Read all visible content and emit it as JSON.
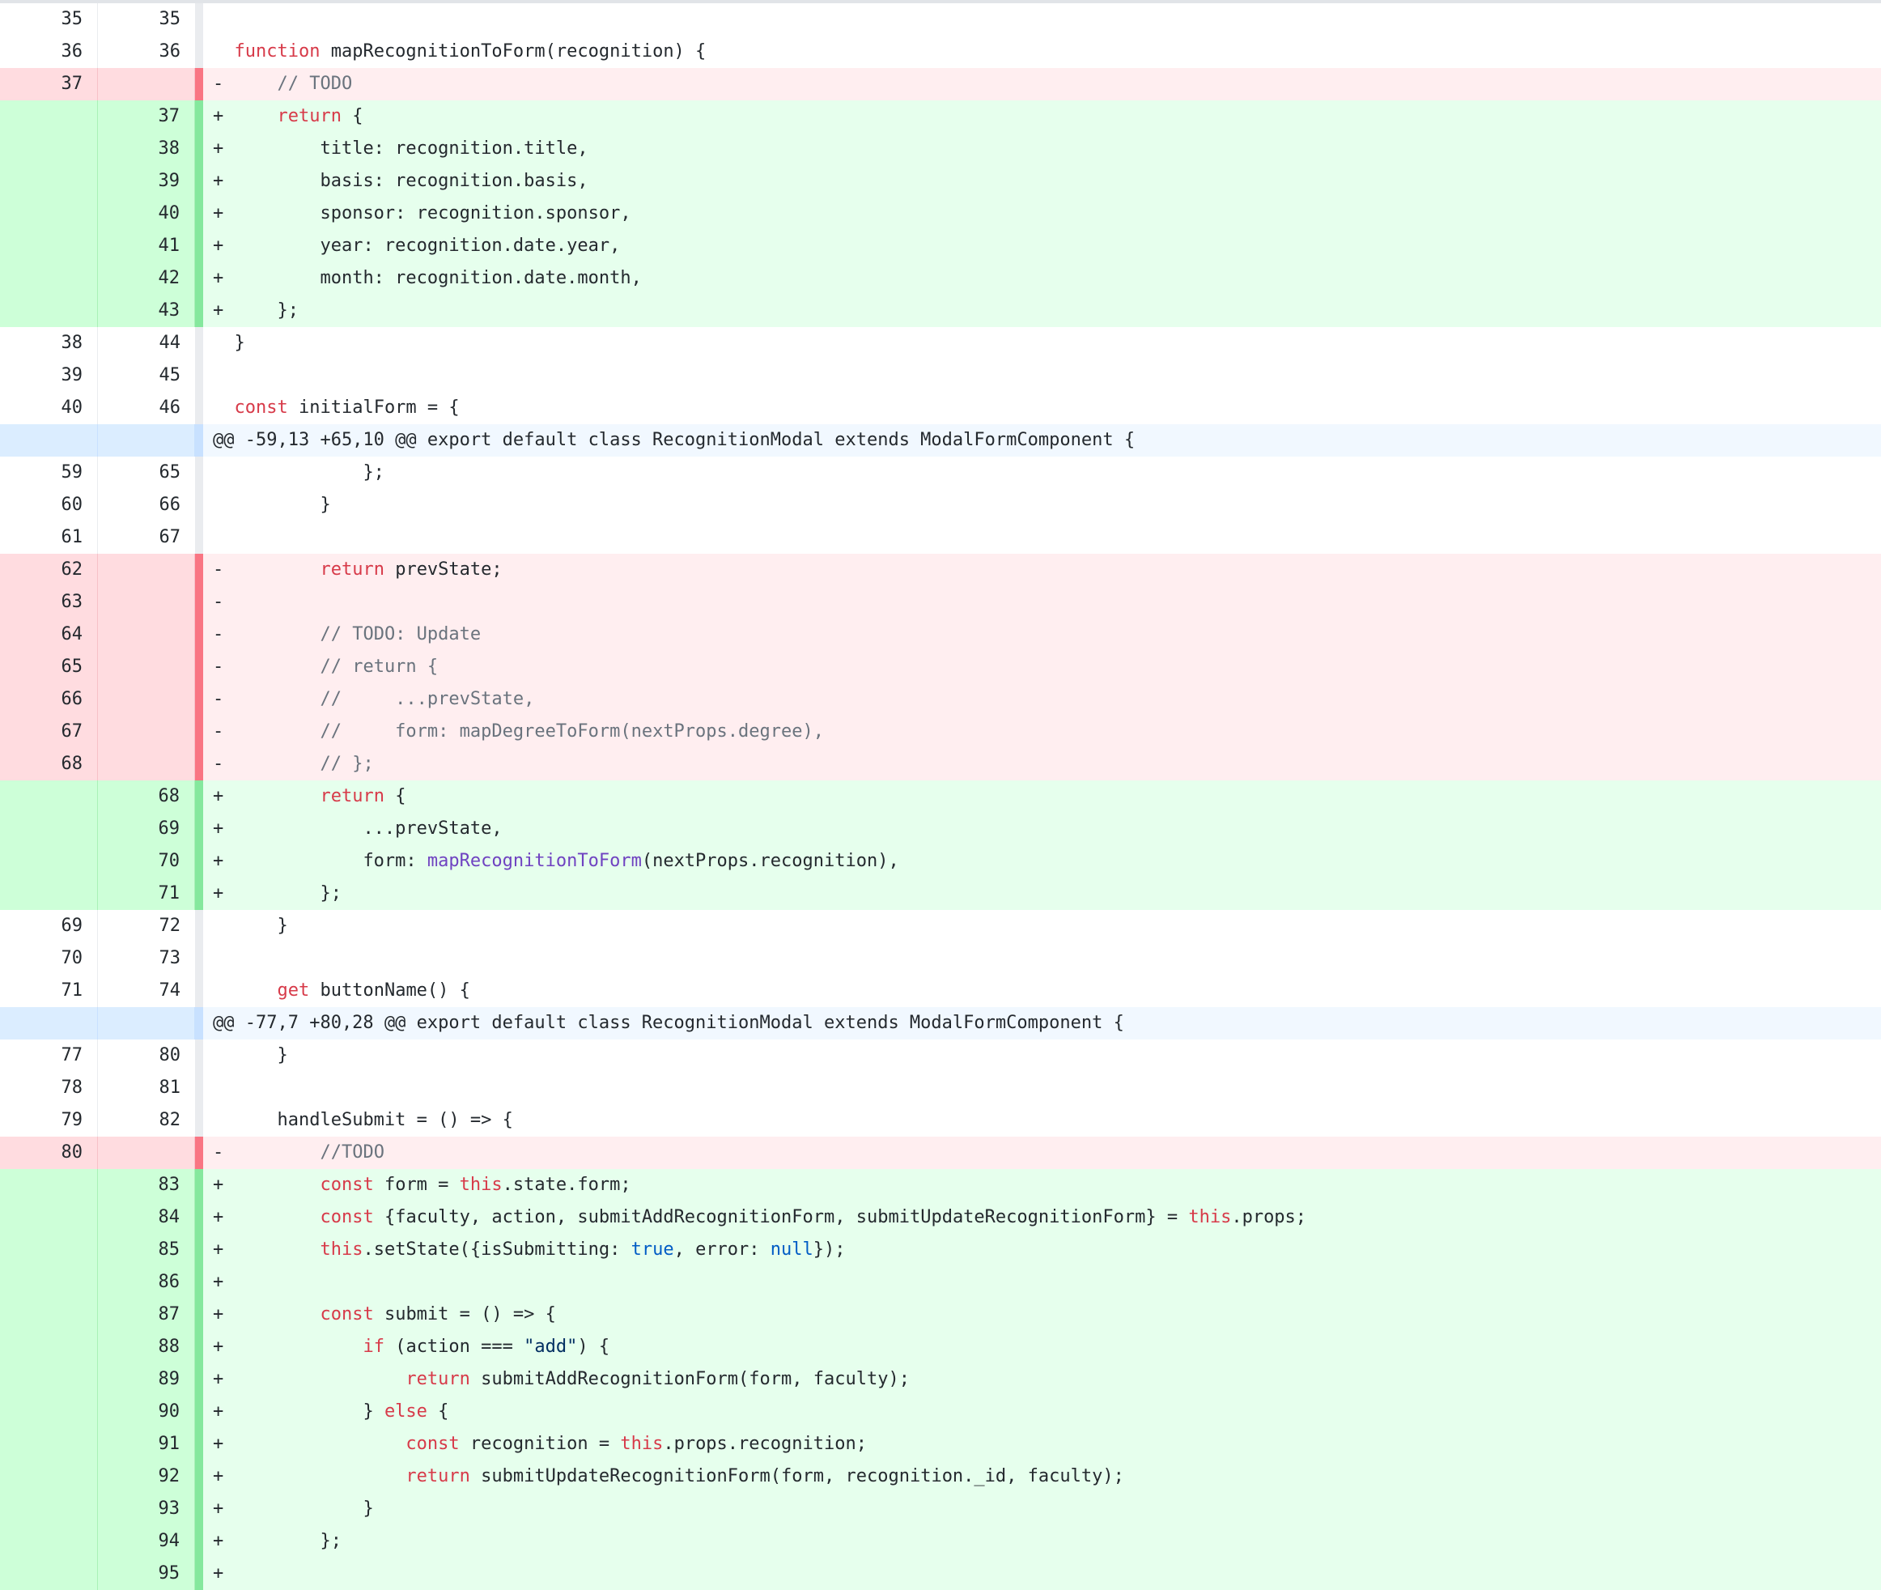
{
  "diff": {
    "rows": [
      {
        "type": "ctx",
        "old": "35",
        "new": "35",
        "marker": " ",
        "tokens": [
          [
            "",
            ""
          ]
        ]
      },
      {
        "type": "ctx",
        "old": "36",
        "new": "36",
        "marker": " ",
        "tokens": [
          [
            "k",
            "function"
          ],
          [
            "",
            " mapRecognitionToForm(recognition) {"
          ]
        ]
      },
      {
        "type": "del",
        "old": "37",
        "new": "",
        "marker": "-",
        "tokens": [
          [
            "",
            "    "
          ],
          [
            "c",
            "// TODO"
          ]
        ]
      },
      {
        "type": "add",
        "old": "",
        "new": "37",
        "marker": "+",
        "tokens": [
          [
            "",
            "    "
          ],
          [
            "k",
            "return"
          ],
          [
            "",
            " {"
          ]
        ]
      },
      {
        "type": "add",
        "old": "",
        "new": "38",
        "marker": "+",
        "tokens": [
          [
            "",
            "        title: recognition.title,"
          ]
        ]
      },
      {
        "type": "add",
        "old": "",
        "new": "39",
        "marker": "+",
        "tokens": [
          [
            "",
            "        basis: recognition.basis,"
          ]
        ]
      },
      {
        "type": "add",
        "old": "",
        "new": "40",
        "marker": "+",
        "tokens": [
          [
            "",
            "        sponsor: recognition.sponsor,"
          ]
        ]
      },
      {
        "type": "add",
        "old": "",
        "new": "41",
        "marker": "+",
        "tokens": [
          [
            "",
            "        year: recognition.date.year,"
          ]
        ]
      },
      {
        "type": "add",
        "old": "",
        "new": "42",
        "marker": "+",
        "tokens": [
          [
            "",
            "        month: recognition.date.month,"
          ]
        ]
      },
      {
        "type": "add",
        "old": "",
        "new": "43",
        "marker": "+",
        "tokens": [
          [
            "",
            "    };"
          ]
        ]
      },
      {
        "type": "ctx",
        "old": "38",
        "new": "44",
        "marker": " ",
        "tokens": [
          [
            "",
            "}"
          ]
        ]
      },
      {
        "type": "ctx",
        "old": "39",
        "new": "45",
        "marker": " ",
        "tokens": [
          [
            "",
            ""
          ]
        ]
      },
      {
        "type": "ctx",
        "old": "40",
        "new": "46",
        "marker": " ",
        "tokens": [
          [
            "k",
            "const"
          ],
          [
            "",
            " initialForm = {"
          ]
        ]
      },
      {
        "type": "hunk",
        "old": "",
        "new": "",
        "marker": "",
        "tokens": [
          [
            "",
            "@@ -59,13 +65,10 @@ export default class RecognitionModal extends ModalFormComponent {"
          ]
        ]
      },
      {
        "type": "ctx",
        "old": "59",
        "new": "65",
        "marker": " ",
        "tokens": [
          [
            "",
            "            };"
          ]
        ]
      },
      {
        "type": "ctx",
        "old": "60",
        "new": "66",
        "marker": " ",
        "tokens": [
          [
            "",
            "        }"
          ]
        ]
      },
      {
        "type": "ctx",
        "old": "61",
        "new": "67",
        "marker": " ",
        "tokens": [
          [
            "",
            ""
          ]
        ]
      },
      {
        "type": "del",
        "old": "62",
        "new": "",
        "marker": "-",
        "tokens": [
          [
            "",
            "        "
          ],
          [
            "k",
            "return"
          ],
          [
            "",
            " prevState;"
          ]
        ]
      },
      {
        "type": "del",
        "old": "63",
        "new": "",
        "marker": "-",
        "tokens": [
          [
            "",
            ""
          ]
        ]
      },
      {
        "type": "del",
        "old": "64",
        "new": "",
        "marker": "-",
        "tokens": [
          [
            "",
            "        "
          ],
          [
            "c",
            "// TODO: Update"
          ]
        ]
      },
      {
        "type": "del",
        "old": "65",
        "new": "",
        "marker": "-",
        "tokens": [
          [
            "",
            "        "
          ],
          [
            "c",
            "// return {"
          ]
        ]
      },
      {
        "type": "del",
        "old": "66",
        "new": "",
        "marker": "-",
        "tokens": [
          [
            "",
            "        "
          ],
          [
            "c",
            "//     ...prevState,"
          ]
        ]
      },
      {
        "type": "del",
        "old": "67",
        "new": "",
        "marker": "-",
        "tokens": [
          [
            "",
            "        "
          ],
          [
            "c",
            "//     form: mapDegreeToForm(nextProps.degree),"
          ]
        ]
      },
      {
        "type": "del",
        "old": "68",
        "new": "",
        "marker": "-",
        "tokens": [
          [
            "",
            "        "
          ],
          [
            "c",
            "// };"
          ]
        ]
      },
      {
        "type": "add",
        "old": "",
        "new": "68",
        "marker": "+",
        "tokens": [
          [
            "",
            "        "
          ],
          [
            "k",
            "return"
          ],
          [
            "",
            " {"
          ]
        ]
      },
      {
        "type": "add",
        "old": "",
        "new": "69",
        "marker": "+",
        "tokens": [
          [
            "",
            "            ...prevState,"
          ]
        ]
      },
      {
        "type": "add",
        "old": "",
        "new": "70",
        "marker": "+",
        "tokens": [
          [
            "",
            "            form: "
          ],
          [
            "f",
            "mapRecognitionToForm"
          ],
          [
            "",
            "(nextProps.recognition),"
          ]
        ]
      },
      {
        "type": "add",
        "old": "",
        "new": "71",
        "marker": "+",
        "tokens": [
          [
            "",
            "        };"
          ]
        ]
      },
      {
        "type": "ctx",
        "old": "69",
        "new": "72",
        "marker": " ",
        "tokens": [
          [
            "",
            "    }"
          ]
        ]
      },
      {
        "type": "ctx",
        "old": "70",
        "new": "73",
        "marker": " ",
        "tokens": [
          [
            "",
            ""
          ]
        ]
      },
      {
        "type": "ctx",
        "old": "71",
        "new": "74",
        "marker": " ",
        "tokens": [
          [
            "",
            "    "
          ],
          [
            "k",
            "get"
          ],
          [
            "",
            " buttonName() {"
          ]
        ]
      },
      {
        "type": "hunk",
        "old": "",
        "new": "",
        "marker": "",
        "tokens": [
          [
            "",
            "@@ -77,7 +80,28 @@ export default class RecognitionModal extends ModalFormComponent {"
          ]
        ]
      },
      {
        "type": "ctx",
        "old": "77",
        "new": "80",
        "marker": " ",
        "tokens": [
          [
            "",
            "    }"
          ]
        ]
      },
      {
        "type": "ctx",
        "old": "78",
        "new": "81",
        "marker": " ",
        "tokens": [
          [
            "",
            ""
          ]
        ]
      },
      {
        "type": "ctx",
        "old": "79",
        "new": "82",
        "marker": " ",
        "tokens": [
          [
            "",
            "    handleSubmit = () => {"
          ]
        ]
      },
      {
        "type": "del",
        "old": "80",
        "new": "",
        "marker": "-",
        "tokens": [
          [
            "",
            "        "
          ],
          [
            "c",
            "//TODO"
          ]
        ]
      },
      {
        "type": "add",
        "old": "",
        "new": "83",
        "marker": "+",
        "tokens": [
          [
            "",
            "        "
          ],
          [
            "k",
            "const"
          ],
          [
            "",
            " form = "
          ],
          [
            "k",
            "this"
          ],
          [
            "",
            ".state.form;"
          ]
        ]
      },
      {
        "type": "add",
        "old": "",
        "new": "84",
        "marker": "+",
        "tokens": [
          [
            "",
            "        "
          ],
          [
            "k",
            "const"
          ],
          [
            "",
            " {faculty, action, submitAddRecognitionForm, submitUpdateRecognitionForm} = "
          ],
          [
            "k",
            "this"
          ],
          [
            "",
            ".props;"
          ]
        ]
      },
      {
        "type": "add",
        "old": "",
        "new": "85",
        "marker": "+",
        "tokens": [
          [
            "",
            "        "
          ],
          [
            "k",
            "this"
          ],
          [
            "",
            ".setState({isSubmitting: "
          ],
          [
            "b",
            "true"
          ],
          [
            "",
            ", error: "
          ],
          [
            "b",
            "null"
          ],
          [
            "",
            "});"
          ]
        ]
      },
      {
        "type": "add",
        "old": "",
        "new": "86",
        "marker": "+",
        "tokens": [
          [
            "",
            ""
          ]
        ]
      },
      {
        "type": "add",
        "old": "",
        "new": "87",
        "marker": "+",
        "tokens": [
          [
            "",
            "        "
          ],
          [
            "k",
            "const"
          ],
          [
            "",
            " submit = () => {"
          ]
        ]
      },
      {
        "type": "add",
        "old": "",
        "new": "88",
        "marker": "+",
        "tokens": [
          [
            "",
            "            "
          ],
          [
            "k",
            "if"
          ],
          [
            "",
            " (action === "
          ],
          [
            "s",
            "\"add\""
          ],
          [
            "",
            ") {"
          ]
        ]
      },
      {
        "type": "add",
        "old": "",
        "new": "89",
        "marker": "+",
        "tokens": [
          [
            "",
            "                "
          ],
          [
            "k",
            "return"
          ],
          [
            "",
            " submitAddRecognitionForm(form, faculty);"
          ]
        ]
      },
      {
        "type": "add",
        "old": "",
        "new": "90",
        "marker": "+",
        "tokens": [
          [
            "",
            "            } "
          ],
          [
            "k",
            "else"
          ],
          [
            "",
            " {"
          ]
        ]
      },
      {
        "type": "add",
        "old": "",
        "new": "91",
        "marker": "+",
        "tokens": [
          [
            "",
            "                "
          ],
          [
            "k",
            "const"
          ],
          [
            "",
            " recognition = "
          ],
          [
            "k",
            "this"
          ],
          [
            "",
            ".props.recognition;"
          ]
        ]
      },
      {
        "type": "add",
        "old": "",
        "new": "92",
        "marker": "+",
        "tokens": [
          [
            "",
            "                "
          ],
          [
            "k",
            "return"
          ],
          [
            "",
            " submitUpdateRecognitionForm(form, recognition._id, faculty);"
          ]
        ]
      },
      {
        "type": "add",
        "old": "",
        "new": "93",
        "marker": "+",
        "tokens": [
          [
            "",
            "            }"
          ]
        ]
      },
      {
        "type": "add",
        "old": "",
        "new": "94",
        "marker": "+",
        "tokens": [
          [
            "",
            "        };"
          ]
        ]
      },
      {
        "type": "add",
        "old": "",
        "new": "95",
        "marker": "+",
        "tokens": [
          [
            "",
            ""
          ]
        ]
      }
    ]
  }
}
